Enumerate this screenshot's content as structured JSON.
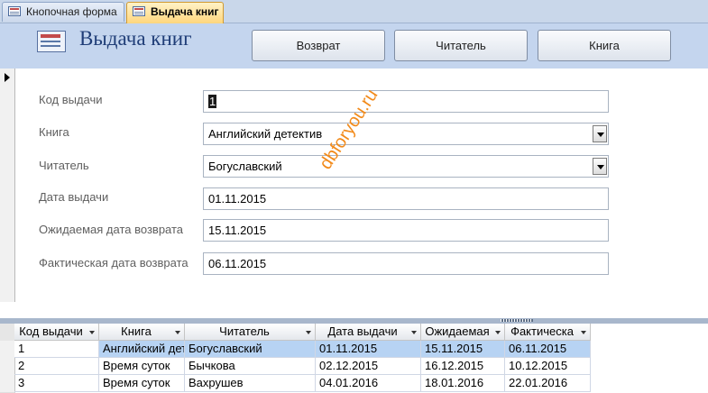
{
  "tabs": [
    {
      "label": "Кнопочная форма"
    },
    {
      "label": "Выдача книг"
    }
  ],
  "header": {
    "title": "Выдача книг",
    "buttons": {
      "return": "Возврат",
      "reader": "Читатель",
      "book": "Книга"
    }
  },
  "form": {
    "fields": [
      {
        "label": "Код выдачи",
        "value": "1"
      },
      {
        "label": "Книга",
        "value": "Английский детектив"
      },
      {
        "label": "Читатель",
        "value": "Богуславский"
      },
      {
        "label": "Дата выдачи",
        "value": "01.11.2015"
      },
      {
        "label": "Ожидаемая дата возврата",
        "value": "15.11.2015"
      },
      {
        "label": "Фактическая дата возврата",
        "value": "06.11.2015"
      }
    ]
  },
  "watermark": "dbforyou.ru",
  "table": {
    "columns": [
      "Код выдачи",
      "Книга",
      "Читатель",
      "Дата выдачи",
      "Ожидаемая",
      "Фактическа"
    ],
    "rows": [
      [
        "1",
        "Английский детектив",
        "Богуславский",
        "01.11.2015",
        "15.11.2015",
        "06.11.2015"
      ],
      [
        "2",
        "Время суток",
        "Бычкова",
        "02.12.2015",
        "16.12.2015",
        "10.12.2015"
      ],
      [
        "3",
        "Время суток",
        "Вахрушев",
        "04.01.2016",
        "18.01.2016",
        "22.01.2016"
      ]
    ]
  },
  "colors": {
    "selected_row": "#b7d3f3",
    "header_band": "#c4d5ee",
    "title": "#1f3d77",
    "watermark": "#f28a1a"
  }
}
